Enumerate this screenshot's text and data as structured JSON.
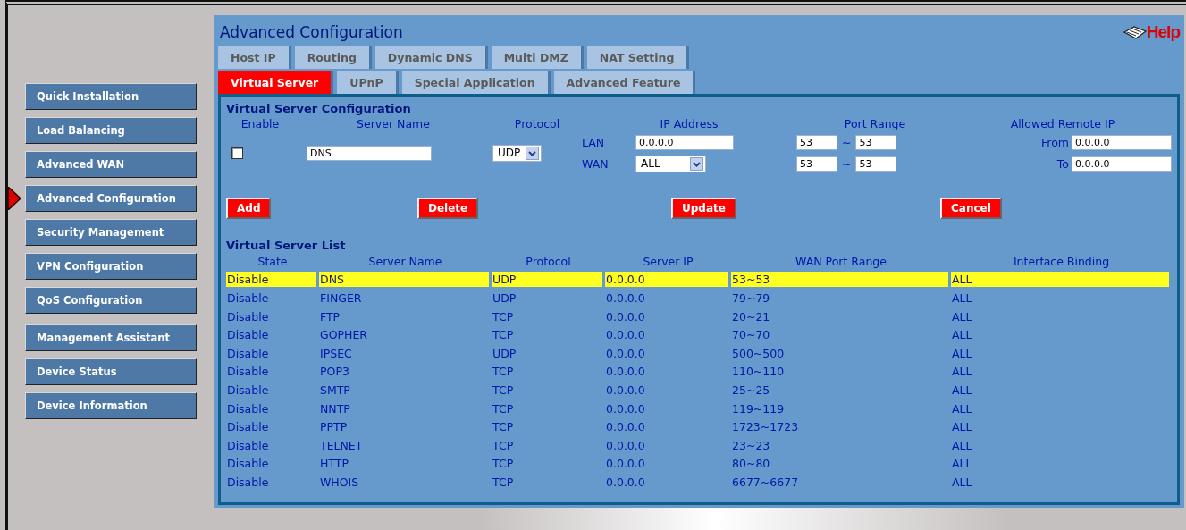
{
  "sidebar": {
    "items": [
      {
        "label": "Quick Installation",
        "selected": false
      },
      {
        "label": "Load Balancing",
        "selected": false
      },
      {
        "label": "Advanced WAN",
        "selected": false
      },
      {
        "label": "Advanced Configuration",
        "selected": true
      },
      {
        "label": "Security Management",
        "selected": false
      },
      {
        "label": "VPN Configuration",
        "selected": false
      },
      {
        "label": "QoS Configuration",
        "selected": false
      },
      {
        "label": "Management Assistant",
        "selected": false
      },
      {
        "label": "Device Status",
        "selected": false
      },
      {
        "label": "Device Information",
        "selected": false
      }
    ]
  },
  "page": {
    "title": "Advanced Configuration",
    "help": "Help"
  },
  "tabs": [
    [
      {
        "label": "Host IP",
        "selected": false
      },
      {
        "label": "Routing",
        "selected": false
      },
      {
        "label": "Dynamic DNS",
        "selected": false
      },
      {
        "label": "Multi DMZ",
        "selected": false
      },
      {
        "label": "NAT Setting",
        "selected": false
      }
    ],
    [
      {
        "label": "Virtual Server",
        "selected": true
      },
      {
        "label": "UPnP",
        "selected": false
      },
      {
        "label": "Special Application",
        "selected": false
      },
      {
        "label": "Advanced Feature",
        "selected": false
      }
    ]
  ],
  "config": {
    "title": "Virtual Server Configuration",
    "headers": {
      "enable": "Enable",
      "server_name": "Server Name",
      "protocol": "Protocol",
      "ip_address": "IP Address",
      "port_range": "Port Range",
      "remote_ip": "Allowed Remote IP"
    },
    "enable_checked": false,
    "server_name": "DNS",
    "protocol": "UDP",
    "lan_label": "LAN",
    "lan_ip": "0.0.0.0",
    "wan_label": "WAN",
    "wan": "ALL",
    "lan_port_from": "53",
    "lan_port_to": "53",
    "wan_port_from": "53",
    "wan_port_to": "53",
    "tilde": "~",
    "from_label": "From",
    "from_ip": "0.0.0.0",
    "to_label": "To",
    "to_ip": "0.0.0.0",
    "buttons": [
      "Add",
      "Delete",
      "Update",
      "Cancel"
    ]
  },
  "list": {
    "title": "Virtual Server List",
    "columns": [
      "State",
      "Server Name",
      "Protocol",
      "Server IP",
      "WAN Port Range",
      "Interface Binding"
    ],
    "rows": [
      {
        "cells": [
          "Disable",
          "DNS",
          "UDP",
          "0.0.0.0",
          "53~53",
          "ALL"
        ],
        "selected": true
      },
      {
        "cells": [
          "Disable",
          "FINGER",
          "UDP",
          "0.0.0.0",
          "79~79",
          "ALL"
        ],
        "selected": false
      },
      {
        "cells": [
          "Disable",
          "FTP",
          "TCP",
          "0.0.0.0",
          "20~21",
          "ALL"
        ],
        "selected": false
      },
      {
        "cells": [
          "Disable",
          "GOPHER",
          "TCP",
          "0.0.0.0",
          "70~70",
          "ALL"
        ],
        "selected": false
      },
      {
        "cells": [
          "Disable",
          "IPSEC",
          "UDP",
          "0.0.0.0",
          "500~500",
          "ALL"
        ],
        "selected": false
      },
      {
        "cells": [
          "Disable",
          "POP3",
          "TCP",
          "0.0.0.0",
          "110~110",
          "ALL"
        ],
        "selected": false
      },
      {
        "cells": [
          "Disable",
          "SMTP",
          "TCP",
          "0.0.0.0",
          "25~25",
          "ALL"
        ],
        "selected": false
      },
      {
        "cells": [
          "Disable",
          "NNTP",
          "TCP",
          "0.0.0.0",
          "119~119",
          "ALL"
        ],
        "selected": false
      },
      {
        "cells": [
          "Disable",
          "PPTP",
          "TCP",
          "0.0.0.0",
          "1723~1723",
          "ALL"
        ],
        "selected": false
      },
      {
        "cells": [
          "Disable",
          "TELNET",
          "TCP",
          "0.0.0.0",
          "23~23",
          "ALL"
        ],
        "selected": false
      },
      {
        "cells": [
          "Disable",
          "HTTP",
          "TCP",
          "0.0.0.0",
          "80~80",
          "ALL"
        ],
        "selected": false
      },
      {
        "cells": [
          "Disable",
          "WHOIS",
          "TCP",
          "0.0.0.0",
          "6677~6677",
          "ALL"
        ],
        "selected": false
      }
    ]
  }
}
